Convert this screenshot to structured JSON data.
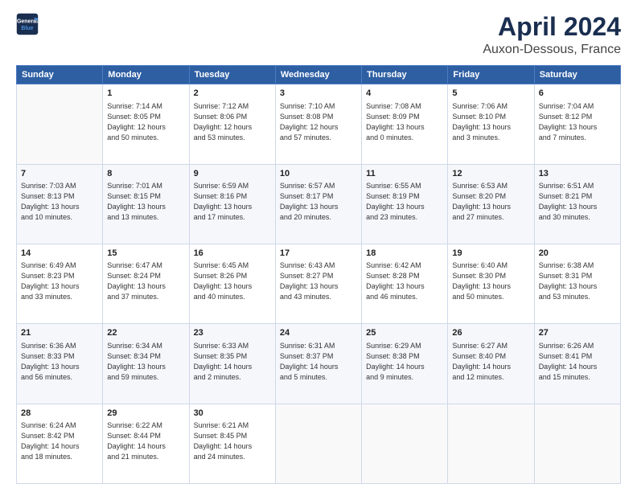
{
  "header": {
    "logo_line1": "General",
    "logo_line2": "Blue",
    "title": "April 2024",
    "subtitle": "Auxon-Dessous, France"
  },
  "weekdays": [
    "Sunday",
    "Monday",
    "Tuesday",
    "Wednesday",
    "Thursday",
    "Friday",
    "Saturday"
  ],
  "weeks": [
    [
      {
        "day": "",
        "content": ""
      },
      {
        "day": "1",
        "content": "Sunrise: 7:14 AM\nSunset: 8:05 PM\nDaylight: 12 hours\nand 50 minutes."
      },
      {
        "day": "2",
        "content": "Sunrise: 7:12 AM\nSunset: 8:06 PM\nDaylight: 12 hours\nand 53 minutes."
      },
      {
        "day": "3",
        "content": "Sunrise: 7:10 AM\nSunset: 8:08 PM\nDaylight: 12 hours\nand 57 minutes."
      },
      {
        "day": "4",
        "content": "Sunrise: 7:08 AM\nSunset: 8:09 PM\nDaylight: 13 hours\nand 0 minutes."
      },
      {
        "day": "5",
        "content": "Sunrise: 7:06 AM\nSunset: 8:10 PM\nDaylight: 13 hours\nand 3 minutes."
      },
      {
        "day": "6",
        "content": "Sunrise: 7:04 AM\nSunset: 8:12 PM\nDaylight: 13 hours\nand 7 minutes."
      }
    ],
    [
      {
        "day": "7",
        "content": "Sunrise: 7:03 AM\nSunset: 8:13 PM\nDaylight: 13 hours\nand 10 minutes."
      },
      {
        "day": "8",
        "content": "Sunrise: 7:01 AM\nSunset: 8:15 PM\nDaylight: 13 hours\nand 13 minutes."
      },
      {
        "day": "9",
        "content": "Sunrise: 6:59 AM\nSunset: 8:16 PM\nDaylight: 13 hours\nand 17 minutes."
      },
      {
        "day": "10",
        "content": "Sunrise: 6:57 AM\nSunset: 8:17 PM\nDaylight: 13 hours\nand 20 minutes."
      },
      {
        "day": "11",
        "content": "Sunrise: 6:55 AM\nSunset: 8:19 PM\nDaylight: 13 hours\nand 23 minutes."
      },
      {
        "day": "12",
        "content": "Sunrise: 6:53 AM\nSunset: 8:20 PM\nDaylight: 13 hours\nand 27 minutes."
      },
      {
        "day": "13",
        "content": "Sunrise: 6:51 AM\nSunset: 8:21 PM\nDaylight: 13 hours\nand 30 minutes."
      }
    ],
    [
      {
        "day": "14",
        "content": "Sunrise: 6:49 AM\nSunset: 8:23 PM\nDaylight: 13 hours\nand 33 minutes."
      },
      {
        "day": "15",
        "content": "Sunrise: 6:47 AM\nSunset: 8:24 PM\nDaylight: 13 hours\nand 37 minutes."
      },
      {
        "day": "16",
        "content": "Sunrise: 6:45 AM\nSunset: 8:26 PM\nDaylight: 13 hours\nand 40 minutes."
      },
      {
        "day": "17",
        "content": "Sunrise: 6:43 AM\nSunset: 8:27 PM\nDaylight: 13 hours\nand 43 minutes."
      },
      {
        "day": "18",
        "content": "Sunrise: 6:42 AM\nSunset: 8:28 PM\nDaylight: 13 hours\nand 46 minutes."
      },
      {
        "day": "19",
        "content": "Sunrise: 6:40 AM\nSunset: 8:30 PM\nDaylight: 13 hours\nand 50 minutes."
      },
      {
        "day": "20",
        "content": "Sunrise: 6:38 AM\nSunset: 8:31 PM\nDaylight: 13 hours\nand 53 minutes."
      }
    ],
    [
      {
        "day": "21",
        "content": "Sunrise: 6:36 AM\nSunset: 8:33 PM\nDaylight: 13 hours\nand 56 minutes."
      },
      {
        "day": "22",
        "content": "Sunrise: 6:34 AM\nSunset: 8:34 PM\nDaylight: 13 hours\nand 59 minutes."
      },
      {
        "day": "23",
        "content": "Sunrise: 6:33 AM\nSunset: 8:35 PM\nDaylight: 14 hours\nand 2 minutes."
      },
      {
        "day": "24",
        "content": "Sunrise: 6:31 AM\nSunset: 8:37 PM\nDaylight: 14 hours\nand 5 minutes."
      },
      {
        "day": "25",
        "content": "Sunrise: 6:29 AM\nSunset: 8:38 PM\nDaylight: 14 hours\nand 9 minutes."
      },
      {
        "day": "26",
        "content": "Sunrise: 6:27 AM\nSunset: 8:40 PM\nDaylight: 14 hours\nand 12 minutes."
      },
      {
        "day": "27",
        "content": "Sunrise: 6:26 AM\nSunset: 8:41 PM\nDaylight: 14 hours\nand 15 minutes."
      }
    ],
    [
      {
        "day": "28",
        "content": "Sunrise: 6:24 AM\nSunset: 8:42 PM\nDaylight: 14 hours\nand 18 minutes."
      },
      {
        "day": "29",
        "content": "Sunrise: 6:22 AM\nSunset: 8:44 PM\nDaylight: 14 hours\nand 21 minutes."
      },
      {
        "day": "30",
        "content": "Sunrise: 6:21 AM\nSunset: 8:45 PM\nDaylight: 14 hours\nand 24 minutes."
      },
      {
        "day": "",
        "content": ""
      },
      {
        "day": "",
        "content": ""
      },
      {
        "day": "",
        "content": ""
      },
      {
        "day": "",
        "content": ""
      }
    ]
  ]
}
